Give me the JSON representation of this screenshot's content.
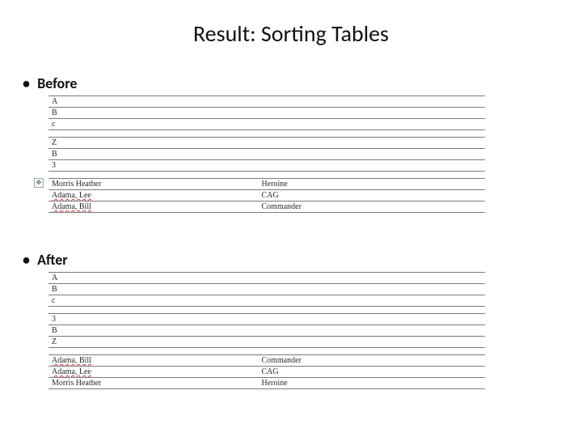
{
  "title": "Result: Sorting Tables",
  "sections": {
    "before": {
      "label": "Before"
    },
    "after": {
      "label": "After"
    }
  },
  "handle_glyph": "✥",
  "before_tables": {
    "t1": {
      "rows": [
        "A",
        "B",
        "c"
      ]
    },
    "t2": {
      "rows": [
        "Z",
        "B",
        "3"
      ]
    },
    "t3": {
      "rows": [
        {
          "c1": {
            "text": "Morris Heather",
            "squiggle": false
          },
          "c2": "Heroine"
        },
        {
          "c1": {
            "text": "Adama, Lee",
            "squiggle": true
          },
          "c2": "CAG"
        },
        {
          "c1": {
            "text": "Adama, Bill",
            "squiggle": true
          },
          "c2": "Commander"
        }
      ]
    }
  },
  "after_tables": {
    "t1": {
      "rows": [
        "A",
        "B",
        "c"
      ]
    },
    "t2": {
      "rows": [
        "3",
        "B",
        "Z"
      ]
    },
    "t3": {
      "rows": [
        {
          "c1": {
            "text": "Adama, Bill",
            "squiggle": true
          },
          "c2": "Commander"
        },
        {
          "c1": {
            "text": "Adama, Lee",
            "squiggle": true
          },
          "c2": "CAG"
        },
        {
          "c1": {
            "text": "Morris Heather",
            "squiggle": false
          },
          "c2": "Heroine"
        }
      ]
    }
  }
}
